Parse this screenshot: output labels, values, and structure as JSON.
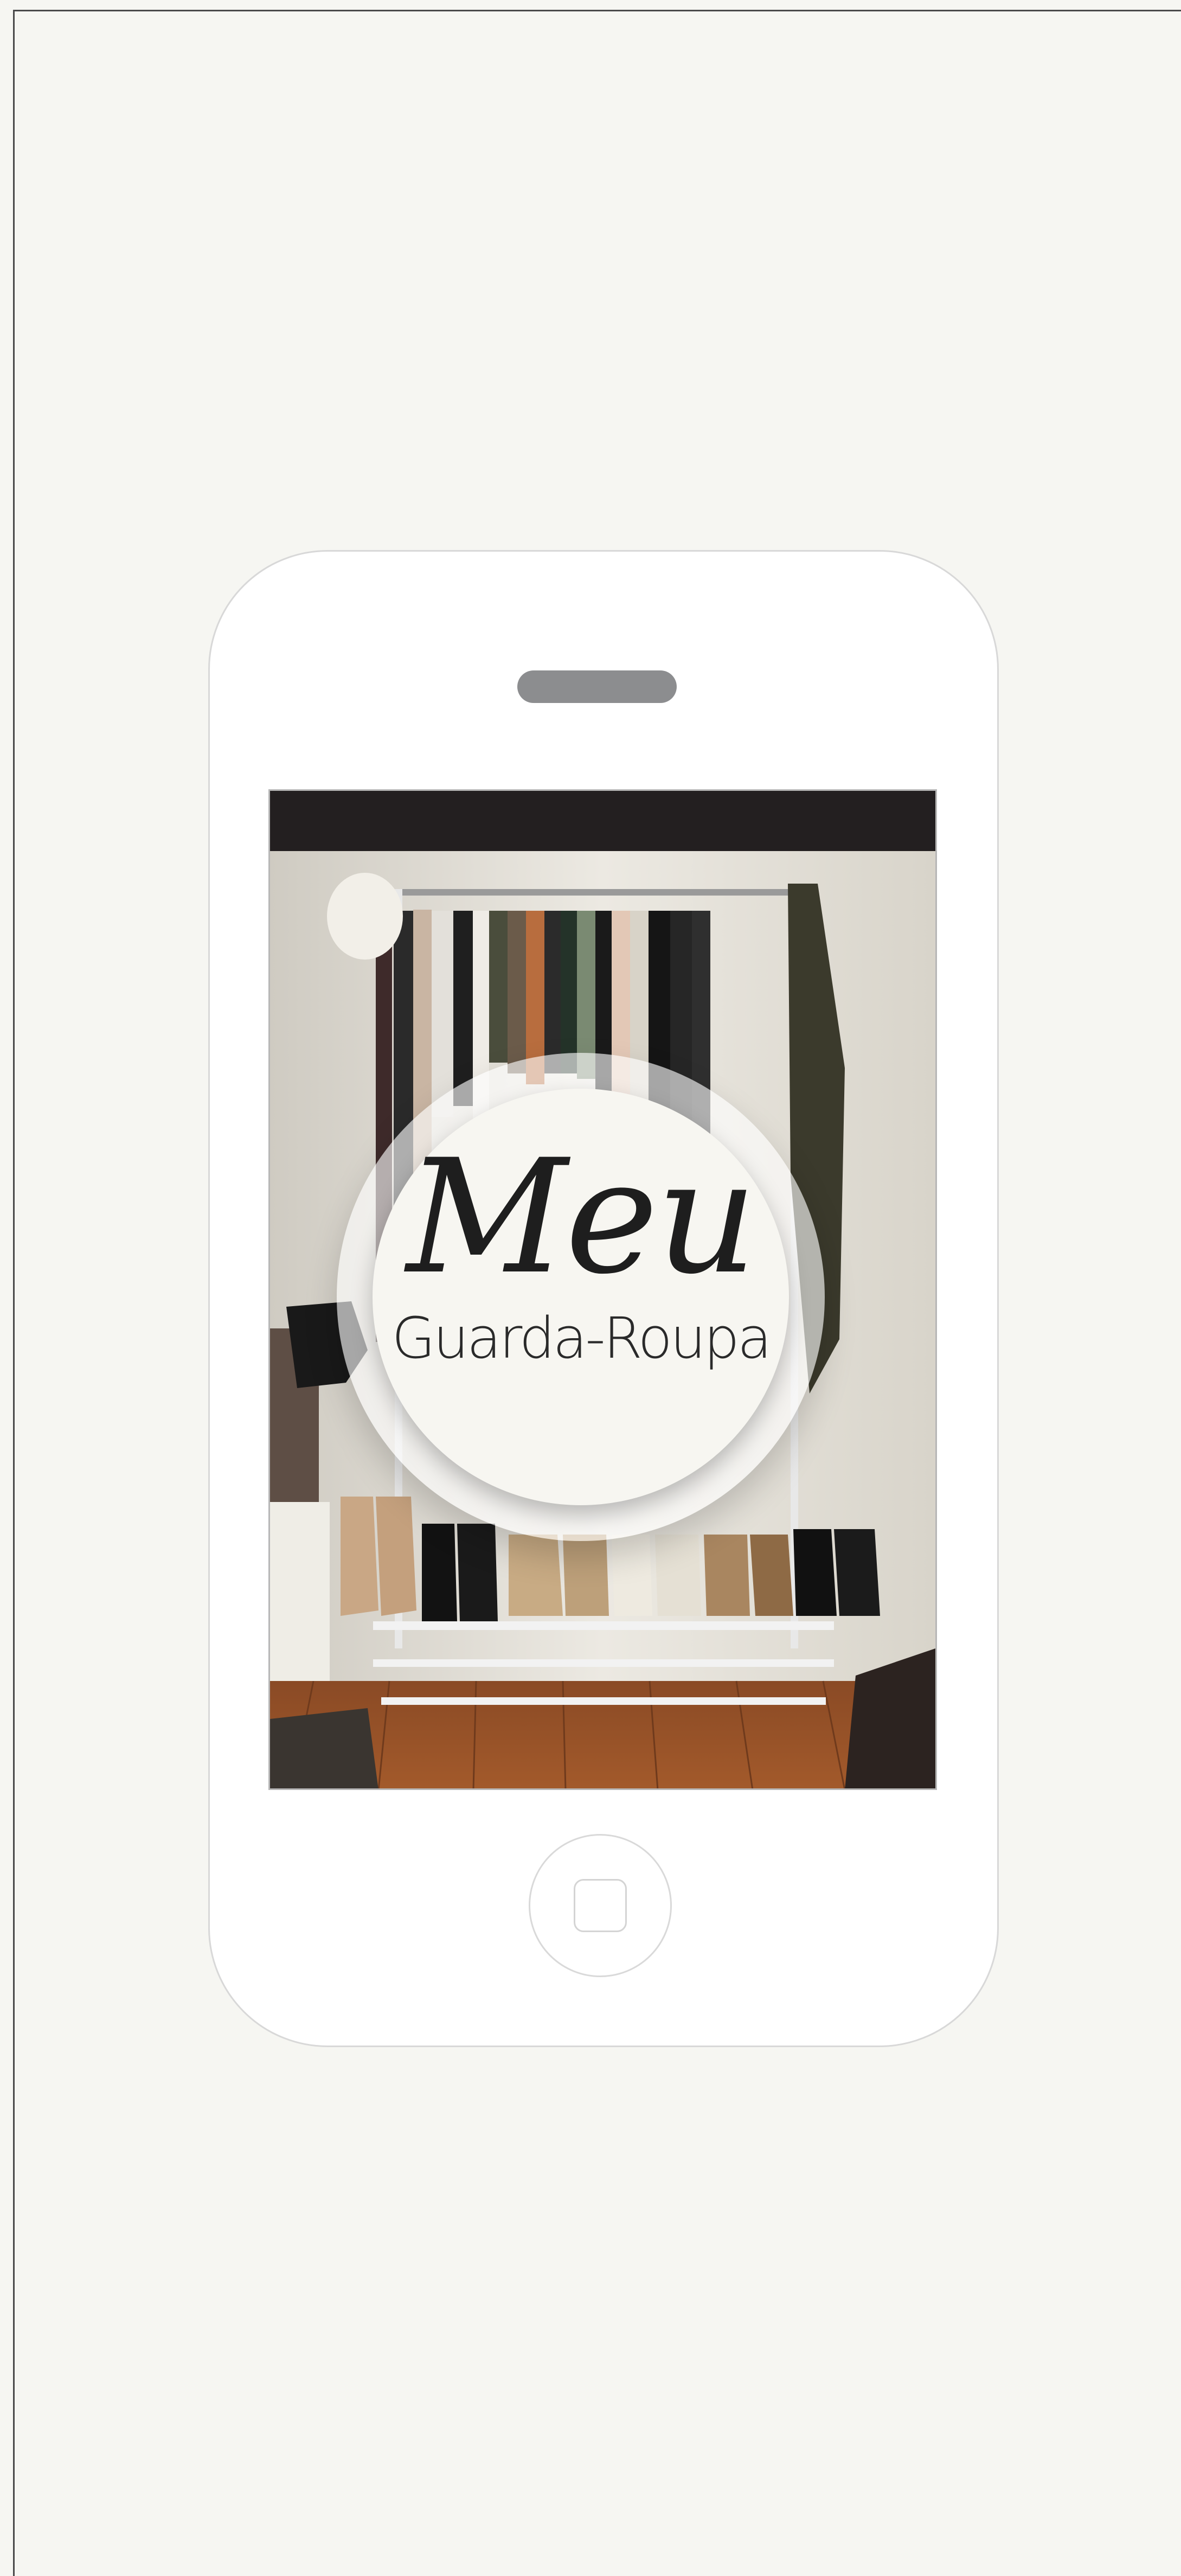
{
  "splash": {
    "logo_title": "Meu",
    "logo_subtitle": "Guarda-Roupa"
  },
  "colors": {
    "background": "#f6f6f2",
    "phone_body": "#ffffff",
    "status_bar": "#231f20",
    "speaker": "#8c8d8f",
    "logo_text": "#1e1e1e"
  },
  "icons": {
    "home": "home-square-icon"
  }
}
